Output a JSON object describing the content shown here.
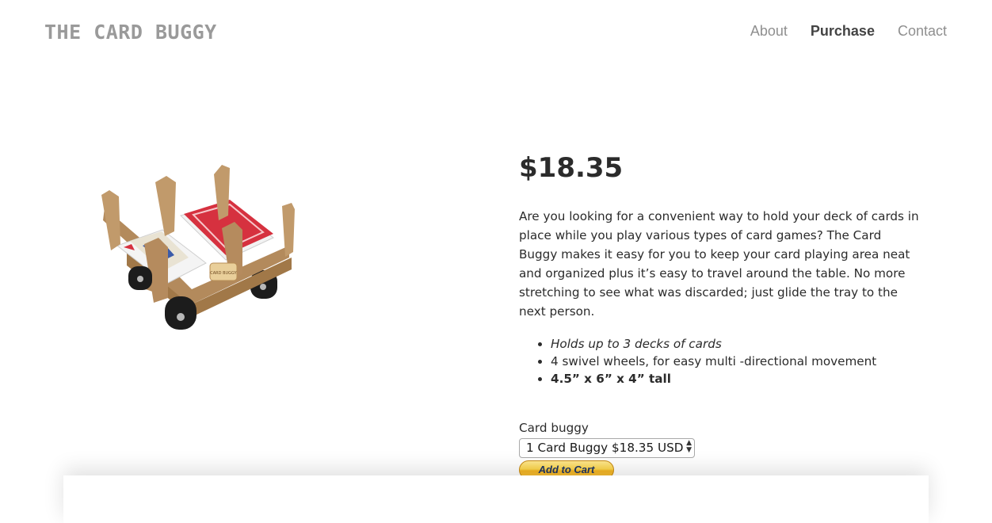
{
  "site": {
    "logo": "THE CARD BUGGY"
  },
  "nav": {
    "items": [
      {
        "label": "About"
      },
      {
        "label": "Purchase"
      },
      {
        "label": "Contact"
      }
    ]
  },
  "product": {
    "price": "$18.35",
    "description": "Are you looking for a convenient way to hold your deck of cards in place while you play various types of card games? The Card Buggy makes it easy for you to keep your card playing area neat and organized plus it’s easy to travel around the table. No more stretching to see what was discarded; just glide the tray to the next person.",
    "features": [
      "Holds up to 3 decks of cards",
      "4 swivel wheels, for easy multi -directional movement",
      "4.5” x 6” x 4” tall"
    ],
    "image_text": "CARD BUGGY"
  },
  "purchase": {
    "option_label": "Card buggy",
    "selected_option": "1 Card Buggy $18.35 USD",
    "add_to_cart": "Add to Cart"
  },
  "colors": {
    "tray": "#c19a6b",
    "card_back": "#d6313f",
    "button": "#f5b523",
    "button_text": "#1f3665"
  }
}
